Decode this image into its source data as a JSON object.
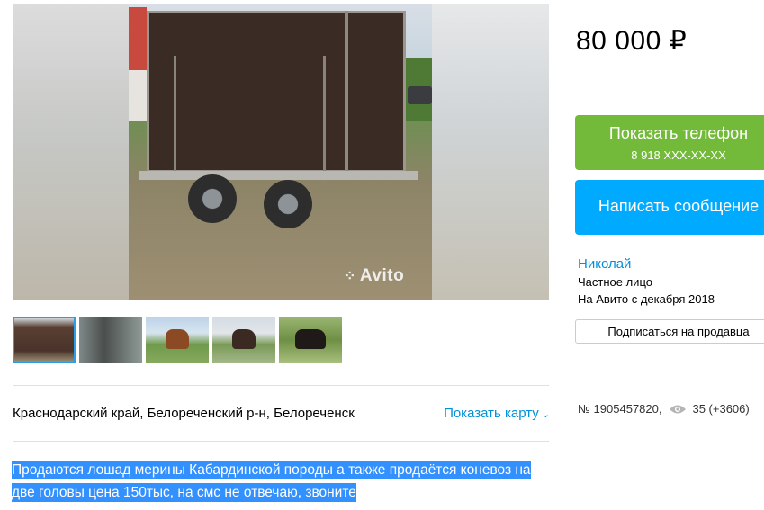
{
  "photo": {
    "watermark": "Avito"
  },
  "thumbnails": [
    {
      "icon": "trailer-photo"
    },
    {
      "icon": "trailer-inside-photo"
    },
    {
      "icon": "brown-horse-photo"
    },
    {
      "icon": "dark-horse-photo"
    },
    {
      "icon": "black-horse-photo"
    }
  ],
  "location": {
    "address": "Краснодарский край, Белореченский р-н, Белореченск",
    "map_link": "Показать карту"
  },
  "description": "Продаются лошад мерины Кабардинской породы а также продаётся коневоз на две головы цена 150тыс, на смс не отвечаю, звоните",
  "price": "80 000 ₽",
  "phone_button": {
    "label": "Показать телефон",
    "number": "8 918 XXX-XX-XX"
  },
  "message_button": {
    "label": "Написать сообщение"
  },
  "seller": {
    "name": "Николай",
    "type": "Частное лицо",
    "since": "На Авито с декабря 2018",
    "subscribe_label": "Подписаться на продавца"
  },
  "meta": {
    "ad_number": "№ 1905457820,",
    "views": "35 (+3606)"
  },
  "colors": {
    "phone_button": "#74ba3a",
    "message_button": "#00aaff",
    "link": "#0091d9",
    "selection": "#3390ff"
  }
}
